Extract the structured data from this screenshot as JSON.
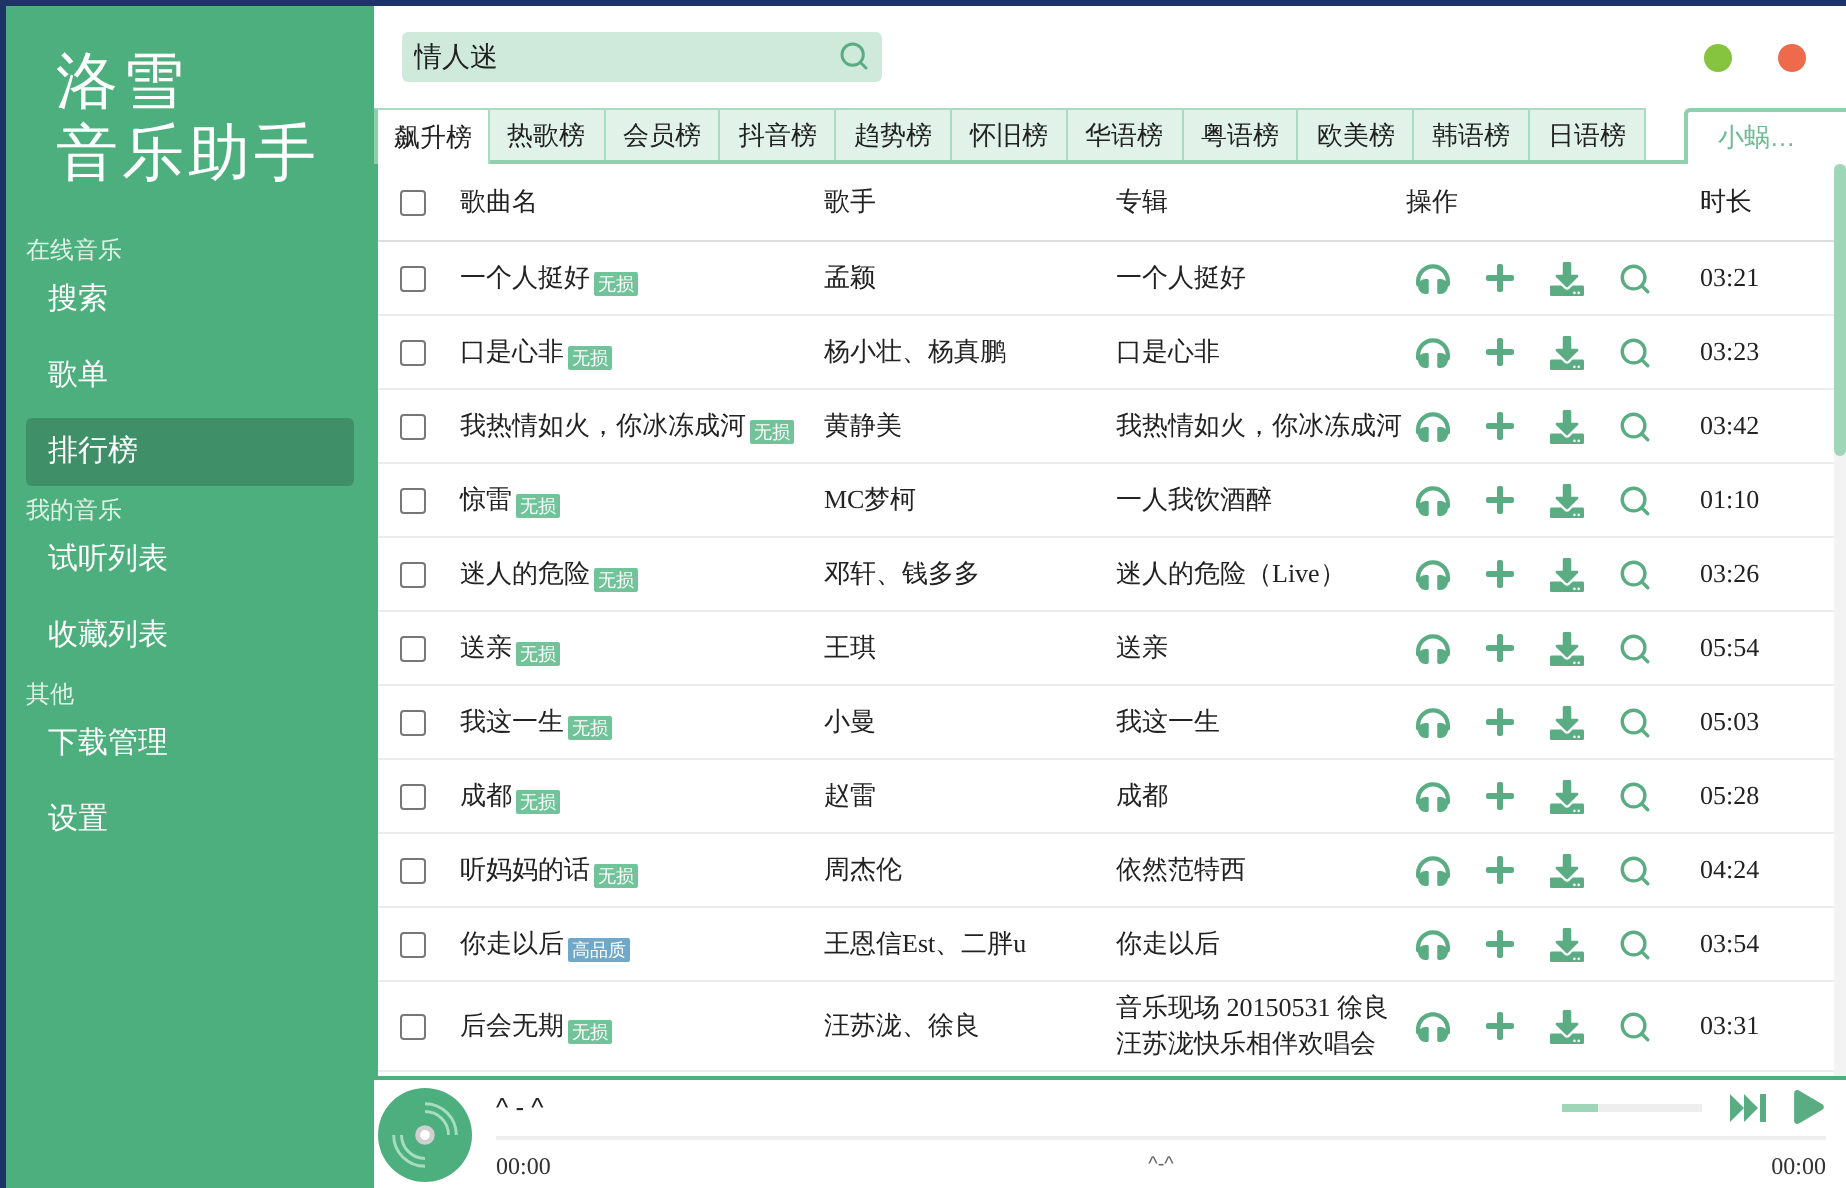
{
  "logo": {
    "lines": [
      "洛雪",
      "音乐助手"
    ]
  },
  "sidebar": {
    "sections": [
      {
        "heading": "在线音乐",
        "items": [
          {
            "label": "搜索",
            "selected": false
          },
          {
            "label": "歌单",
            "selected": false
          },
          {
            "label": "排行榜",
            "selected": true
          }
        ]
      },
      {
        "heading": "我的音乐",
        "items": [
          {
            "label": "试听列表",
            "selected": false
          },
          {
            "label": "收藏列表",
            "selected": false
          }
        ]
      },
      {
        "heading": "其他",
        "items": [
          {
            "label": "下载管理",
            "selected": false
          },
          {
            "label": "设置",
            "selected": false
          }
        ]
      }
    ]
  },
  "search": {
    "value": "情人迷"
  },
  "window_buttons": [
    {
      "color": "#86c440"
    },
    {
      "color": "#ee6a4c"
    }
  ],
  "tabs": [
    {
      "label": "飙升榜",
      "selected": true
    },
    {
      "label": "热歌榜",
      "selected": false
    },
    {
      "label": "会员榜",
      "selected": false
    },
    {
      "label": "抖音榜",
      "selected": false
    },
    {
      "label": "趋势榜",
      "selected": false
    },
    {
      "label": "怀旧榜",
      "selected": false
    },
    {
      "label": "华语榜",
      "selected": false
    },
    {
      "label": "粤语榜",
      "selected": false
    },
    {
      "label": "欧美榜",
      "selected": false
    },
    {
      "label": "韩语榜",
      "selected": false
    },
    {
      "label": "日语榜",
      "selected": false
    }
  ],
  "source_tab": {
    "label": "小蜗…"
  },
  "table": {
    "select_all": {
      "checked": false
    },
    "columns": [
      "歌曲名",
      "歌手",
      "专辑",
      "操作",
      "时长"
    ],
    "rows": [
      {
        "checked": false,
        "title": "一个人挺好",
        "badge": {
          "text": "无损",
          "color": "#72c39a"
        },
        "artist": "孟颖",
        "album": "一个人挺好",
        "duration": "03:21"
      },
      {
        "checked": false,
        "title": "口是心非",
        "badge": {
          "text": "无损",
          "color": "#72c39a"
        },
        "artist": "杨小壮、杨真鹏",
        "album": "口是心非",
        "duration": "03:23"
      },
      {
        "checked": false,
        "title": "我热情如火，你冰冻成河",
        "badge": {
          "text": "无损",
          "color": "#72c39a"
        },
        "artist": "黄静美",
        "album": "我热情如火，你冰冻成河",
        "duration": "03:42"
      },
      {
        "checked": false,
        "title": "惊雷",
        "badge": {
          "text": "无损",
          "color": "#72c39a"
        },
        "artist": "MC梦柯",
        "album": "一人我饮酒醉",
        "duration": "01:10"
      },
      {
        "checked": false,
        "title": "迷人的危险",
        "badge": {
          "text": "无损",
          "color": "#72c39a"
        },
        "artist": "邓轩、钱多多",
        "album": "迷人的危险（Live）",
        "duration": "03:26"
      },
      {
        "checked": false,
        "title": "送亲",
        "badge": {
          "text": "无损",
          "color": "#72c39a"
        },
        "artist": "王琪",
        "album": "送亲",
        "duration": "05:54"
      },
      {
        "checked": false,
        "title": "我这一生",
        "badge": {
          "text": "无损",
          "color": "#72c39a"
        },
        "artist": "小曼",
        "album": "我这一生",
        "duration": "05:03"
      },
      {
        "checked": false,
        "title": "成都",
        "badge": {
          "text": "无损",
          "color": "#72c39a"
        },
        "artist": "赵雷",
        "album": "成都",
        "duration": "05:28"
      },
      {
        "checked": false,
        "title": "听妈妈的话",
        "badge": {
          "text": "无损",
          "color": "#72c39a"
        },
        "artist": "周杰伦",
        "album": "依然范特西",
        "duration": "04:24"
      },
      {
        "checked": false,
        "title": "你走以后",
        "badge": {
          "text": "高品质",
          "color": "#6fa8c8"
        },
        "artist": "王恩信Est、二胖u",
        "album": "你走以后",
        "duration": "03:54"
      },
      {
        "checked": false,
        "title": "后会无期",
        "badge": {
          "text": "无损",
          "color": "#72c39a"
        },
        "artist": "汪苏泷、徐良",
        "album": "音乐现场 20150531 徐良汪苏泷快乐相伴欢唱会",
        "duration": "03:31"
      }
    ]
  },
  "player": {
    "title": "^ - ^",
    "elapsed": "00:00",
    "lyric": "^-^",
    "total": "00:00",
    "progress": {
      "level": 0
    },
    "volume": {
      "level": 0.25
    }
  }
}
